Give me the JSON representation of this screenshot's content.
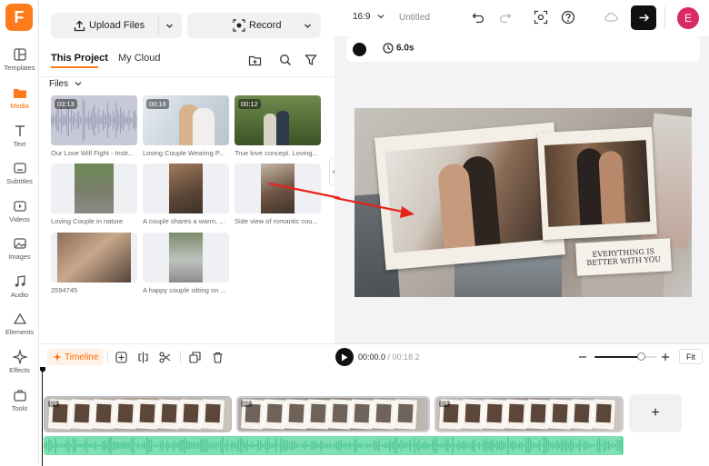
{
  "app": {
    "logo_letter": "F",
    "accent": "#ff7a1a"
  },
  "rail": [
    {
      "label": "Templates",
      "icon": "templates-icon"
    },
    {
      "label": "Media",
      "icon": "media-icon",
      "active": true
    },
    {
      "label": "Text",
      "icon": "text-icon"
    },
    {
      "label": "Subtitles",
      "icon": "subtitles-icon"
    },
    {
      "label": "Videos",
      "icon": "videos-icon"
    },
    {
      "label": "Images",
      "icon": "images-icon"
    },
    {
      "label": "Audio",
      "icon": "audio-icon"
    },
    {
      "label": "Elements",
      "icon": "elements-icon"
    },
    {
      "label": "Effects",
      "icon": "effects-icon"
    },
    {
      "label": "Tools",
      "icon": "tools-icon"
    }
  ],
  "panel": {
    "upload_label": "Upload Files",
    "record_label": "Record",
    "tabs": [
      "This Project",
      "My Cloud"
    ],
    "files_label": "Files",
    "items": [
      {
        "caption": "Our Love Will Fight - Instr...",
        "duration": "03:13",
        "kind": "audio"
      },
      {
        "caption": "Loving Couple Wearing P...",
        "duration": "00:18",
        "kind": "video"
      },
      {
        "caption": "True love concept. Loving...",
        "duration": "00:12",
        "kind": "video"
      },
      {
        "caption": "Loving Couple in nature",
        "duration": "",
        "kind": "image"
      },
      {
        "caption": "A couple shares a warm, ...",
        "duration": "",
        "kind": "image"
      },
      {
        "caption": "Side view of romantic cou...",
        "duration": "",
        "kind": "image"
      },
      {
        "caption": "2594745",
        "duration": "",
        "kind": "image"
      },
      {
        "caption": "A happy couple sitting on ...",
        "duration": "",
        "kind": "image"
      }
    ]
  },
  "topbar": {
    "aspect": "16:9",
    "title": "Untitled",
    "avatar_letter": "E"
  },
  "preview_toolbar": {
    "duration": "6.0s"
  },
  "canvas": {
    "overlay_text": "EVERYTHING IS BETTER WITH YOU"
  },
  "timeline": {
    "tab_label": "Timeline",
    "current_time": "00:00.0",
    "total_time": "00:18.2",
    "fit_label": "Fit",
    "zoom_fraction": 0.75,
    "clips": [
      "01",
      "02",
      "03"
    ],
    "add_label": "+"
  }
}
